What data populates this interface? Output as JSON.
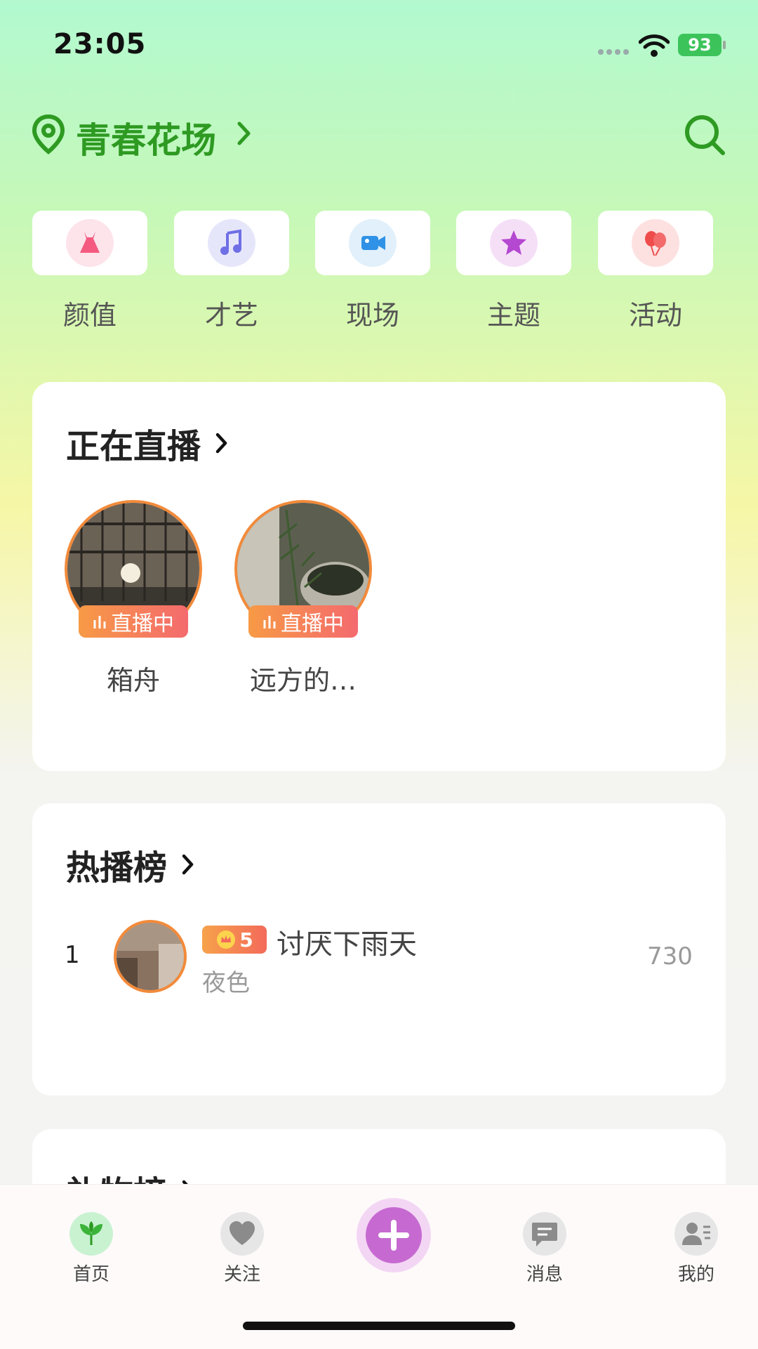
{
  "status_bar": {
    "time": "23:05",
    "battery": "93"
  },
  "header": {
    "location": "青春花场"
  },
  "categories": [
    {
      "label": "颜值",
      "icon": "dress-icon",
      "color": "#f45a80"
    },
    {
      "label": "才艺",
      "icon": "music-note-icon",
      "color": "#6f6fe6"
    },
    {
      "label": "现场",
      "icon": "video-camera-icon",
      "color": "#2f92e6"
    },
    {
      "label": "主题",
      "icon": "star-icon",
      "color": "#b548d0"
    },
    {
      "label": "活动",
      "icon": "balloon-icon",
      "color": "#ef4c4c"
    }
  ],
  "live_section": {
    "title": "正在直播",
    "items": [
      {
        "name": "箱舟",
        "badge": "直播中"
      },
      {
        "name": "远方的…",
        "badge": "直播中"
      }
    ]
  },
  "hot_section": {
    "title": "热播榜",
    "rows": [
      {
        "rank": "1",
        "level": "5",
        "name": "讨厌下雨天",
        "subtitle": "夜色",
        "score": "730"
      }
    ]
  },
  "gift_section": {
    "title": "礼物榜"
  },
  "tabbar": {
    "tabs": [
      {
        "label": "首页",
        "icon": "home-plant-icon"
      },
      {
        "label": "关注",
        "icon": "heart-icon"
      },
      {
        "label": "消息",
        "icon": "message-icon"
      },
      {
        "label": "我的",
        "icon": "profile-icon"
      }
    ],
    "center": "plus-icon"
  }
}
